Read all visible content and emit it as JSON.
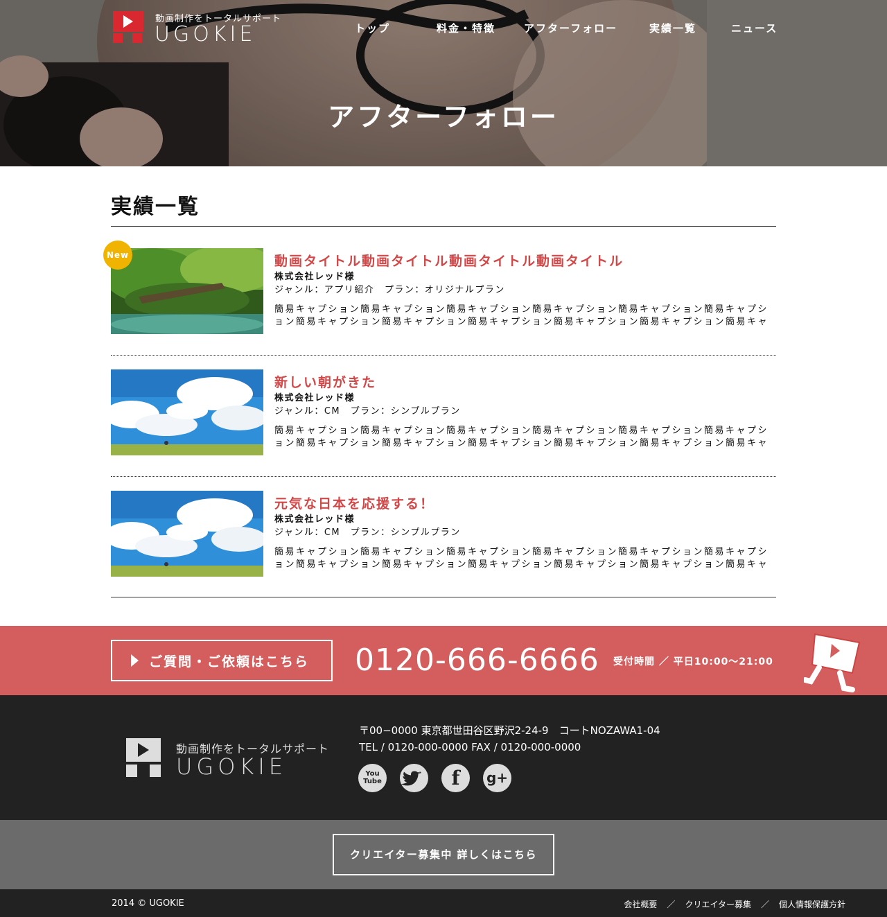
{
  "header": {
    "logo_tagline": "動画制作をトータルサポート",
    "logo_wordmark": "UGOKIE",
    "nav": [
      {
        "label": "トップ"
      },
      {
        "label": "料金・特徴"
      },
      {
        "label": "アフターフォロー"
      },
      {
        "label": "実績一覧"
      },
      {
        "label": "ニュース"
      }
    ],
    "page_title": "アフターフォロー"
  },
  "main": {
    "section_title": "実績一覧",
    "works": [
      {
        "badge": "New",
        "title": "動画タイトル動画タイトル動画タイトル動画タイトル",
        "client": "株式会社レッド様",
        "meta": "ジャンル：アプリ紹介　プラン：オリジナルプラン",
        "caption": "簡易キャプション簡易キャプション簡易キャプション簡易キャプション簡易キャプション簡易キャプション簡易キャプション簡易キャプション簡易キャプション簡易キャプション簡易キャプション簡易キャプシ",
        "thumb_icon": "forest-stream-image"
      },
      {
        "badge": "",
        "title": "新しい朝がきた",
        "client": "株式会社レッド様",
        "meta": "ジャンル：CM　プラン：シンプルプラン",
        "caption": "簡易キャプション簡易キャプション簡易キャプション簡易キャプション簡易キャプション簡易キャプション簡易キャプション簡易キャプション簡易キャプション簡易キャプション簡易キャプション簡易キャプシ",
        "thumb_icon": "sky-field-image"
      },
      {
        "badge": "",
        "title": "元気な日本を応援する！",
        "client": "株式会社レッド様",
        "meta": "ジャンル：CM　プラン：シンプルプラン",
        "caption": "簡易キャプション簡易キャプション簡易キャプション簡易キャプション簡易キャプション簡易キャプション簡易キャプション簡易キャプション簡易キャプション簡易キャプション簡易キャプション簡易キャプシ",
        "thumb_icon": "sky-field-image"
      }
    ]
  },
  "contact": {
    "button_label": "ご質問・ご依頼はこちら",
    "phone": "0120-666-6666",
    "hours": "受付時間 ／ 平日10:00〜21:00"
  },
  "footer": {
    "logo_tagline": "動画制作をトータルサポート",
    "logo_wordmark": "UGOKIE",
    "address": "〒00−0000 東京都世田谷区野沢2-24-9　コートNOZAWA1-04",
    "tel_fax": "TEL / 0120-000-0000  FAX / 0120-000-0000",
    "social": [
      {
        "icon": "youtube-icon",
        "glyph": "You Tube"
      },
      {
        "icon": "twitter-icon",
        "glyph": ""
      },
      {
        "icon": "facebook-icon",
        "glyph": "f"
      },
      {
        "icon": "google-plus-icon",
        "glyph": "g+"
      }
    ],
    "creator_button": "クリエイター募集中 詳しくはこちら",
    "copyright": "2014 © UGOKIE",
    "links": [
      {
        "label": "会社概要"
      },
      {
        "label": "クリエイター募集"
      },
      {
        "label": "個人情報保護方針"
      }
    ]
  },
  "colors": {
    "accent_red": "#d45d5d",
    "title_red": "#d04848",
    "badge_yellow": "#f0b400",
    "footer_dark": "#222222",
    "footer_gray": "#6b6b6b"
  }
}
